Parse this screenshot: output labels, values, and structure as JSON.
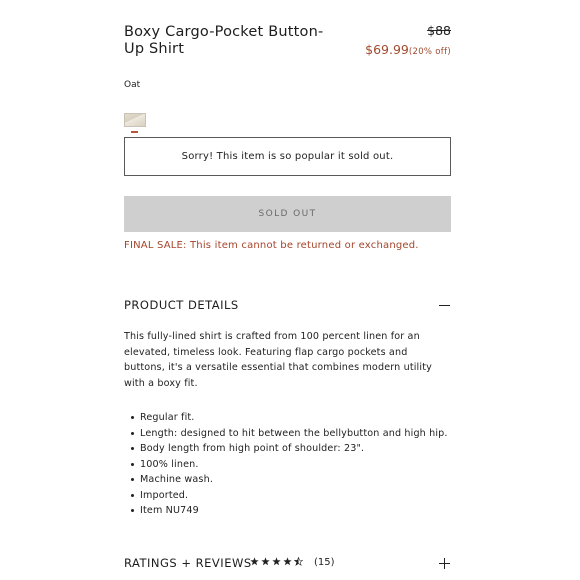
{
  "product": {
    "title": "Boxy Cargo-Pocket Button-Up Shirt",
    "original_price": "$88",
    "sale_price": "$69.99",
    "discount": "(20% off)",
    "color_label": "Oat",
    "swatch_color": "#ddd5c6",
    "sold_out_notice": "Sorry! This item is so popular it sold out.",
    "sold_out_button": "SOLD OUT",
    "final_sale": "FINAL SALE: This item cannot be returned or exchanged."
  },
  "details": {
    "heading": "PRODUCT DETAILS",
    "toggle_icon": "minus-icon",
    "description": "This fully-lined shirt is crafted from 100 percent linen for an elevated, timeless look. Featuring flap cargo pockets and buttons, it's a versatile essential that combines modern utility with a boxy fit.",
    "bullets": [
      "Regular fit.",
      "Length: designed to hit between the bellybutton and high hip.",
      "Body length from high point of shoulder: 23\".",
      "100% linen.",
      "Machine wash.",
      "Imported.",
      "Item NU749"
    ]
  },
  "reviews": {
    "heading": "RATINGS + REVIEWS",
    "rating": 4.5,
    "max_rating": 5,
    "count": "(15)",
    "toggle_icon": "plus-icon"
  },
  "colors": {
    "accent": "#a4452b",
    "button_bg": "#cfcfcf"
  }
}
